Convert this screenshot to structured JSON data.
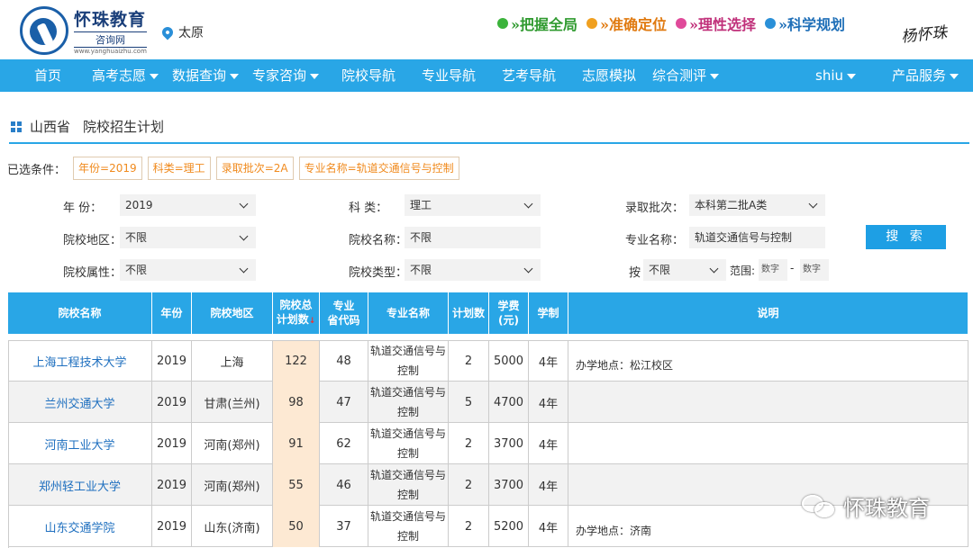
{
  "header": {
    "logo_title": "怀珠教育",
    "logo_sub": "咨询网",
    "logo_url": "www.yanghuaizhu.com",
    "city": "太原",
    "slogans": [
      {
        "text": "»把握全局",
        "color": "#2f9a2f",
        "dot": "#3bb33b"
      },
      {
        "text": "»准确定位",
        "color": "#e07a10",
        "dot": "#f0a020"
      },
      {
        "text": "»理性选择",
        "color": "#c0307a",
        "dot": "#e04a9a"
      },
      {
        "text": "»科学规划",
        "color": "#1f6fb8",
        "dot": "#2a90d8"
      }
    ],
    "signature": "杨怀珠"
  },
  "nav": {
    "items": [
      {
        "label": "首页",
        "dropdown": false
      },
      {
        "label": "高考志愿",
        "dropdown": true
      },
      {
        "label": "数据查询",
        "dropdown": true
      },
      {
        "label": "专家咨询",
        "dropdown": true
      },
      {
        "label": "院校导航",
        "dropdown": false
      },
      {
        "label": "专业导航",
        "dropdown": false
      },
      {
        "label": "艺考导航",
        "dropdown": false
      },
      {
        "label": "志愿模拟",
        "dropdown": false
      },
      {
        "label": "综合测评",
        "dropdown": true
      },
      {
        "label": "shiu",
        "dropdown": true
      },
      {
        "label": "产品服务",
        "dropdown": true
      }
    ],
    "bg_color": "#29a6e6"
  },
  "page": {
    "province": "山西省",
    "title": "院校招生计划"
  },
  "selected_filters": {
    "label": "已选条件：",
    "chips": [
      "年份=2019",
      "科类=理工",
      "录取批次=2A",
      "专业名称=轨道交通信号与控制"
    ]
  },
  "form": {
    "year_label": "年    份：",
    "year_value": "2019",
    "subject_label": "科    类：",
    "subject_value": "理工",
    "batch_label": "录取批次：",
    "batch_value": "本科第二批A类",
    "region_label": "院校地区：",
    "region_value": "不限",
    "school_name_label": "院校名称：",
    "school_name_value": "不限",
    "major_name_label": "专业名称：",
    "major_name_value": "轨道交通信号与控制",
    "attr_label": "院校属性：",
    "attr_value": "不限",
    "type_label": "院校类型：",
    "type_value": "不限",
    "by_label": "按",
    "by_value": "不限",
    "range_label": "范围:",
    "range_from_placeholder": "数字",
    "range_dash": "-",
    "range_to_placeholder": "数字",
    "search_label": "搜 索"
  },
  "table": {
    "headers": [
      "院校名称",
      "年份",
      "院校地区",
      "院校总计划数",
      "专业省代码",
      "专业名称",
      "计划数",
      "学费(元)",
      "学制",
      "说明"
    ],
    "header_lines": [
      [
        "院校名称"
      ],
      [
        "年份"
      ],
      [
        "院校地区"
      ],
      [
        "院校总",
        "计划数"
      ],
      [
        "专业",
        "省代码"
      ],
      [
        "专业名称"
      ],
      [
        "计划数"
      ],
      [
        "学费",
        "(元)"
      ],
      [
        "学制"
      ],
      [
        "说明"
      ]
    ],
    "sort_mark": "↓",
    "rows": [
      {
        "school": "上海工程技术大学",
        "year": "2019",
        "region": "上海",
        "total": "122",
        "code": "48",
        "major": "轨道交通信号与控制",
        "plan": "2",
        "fee": "5000",
        "length": "4年",
        "note": "办学地点：松江校区"
      },
      {
        "school": "兰州交通大学",
        "year": "2019",
        "region": "甘肃(兰州)",
        "total": "98",
        "code": "47",
        "major": "轨道交通信号与控制",
        "plan": "5",
        "fee": "4700",
        "length": "4年",
        "note": ""
      },
      {
        "school": "河南工业大学",
        "year": "2019",
        "region": "河南(郑州)",
        "total": "91",
        "code": "62",
        "major": "轨道交通信号与控制",
        "plan": "2",
        "fee": "3700",
        "length": "4年",
        "note": ""
      },
      {
        "school": "郑州轻工业大学",
        "year": "2019",
        "region": "河南(郑州)",
        "total": "55",
        "code": "46",
        "major": "轨道交通信号与控制",
        "plan": "2",
        "fee": "3700",
        "length": "4年",
        "note": ""
      },
      {
        "school": "山东交通学院",
        "year": "2019",
        "region": "山东(济南)",
        "total": "50",
        "code": "37",
        "major": "轨道交通信号与控制",
        "plan": "2",
        "fee": "5200",
        "length": "4年",
        "note": "办学地点：济南"
      }
    ]
  },
  "watermark": "怀珠教育"
}
